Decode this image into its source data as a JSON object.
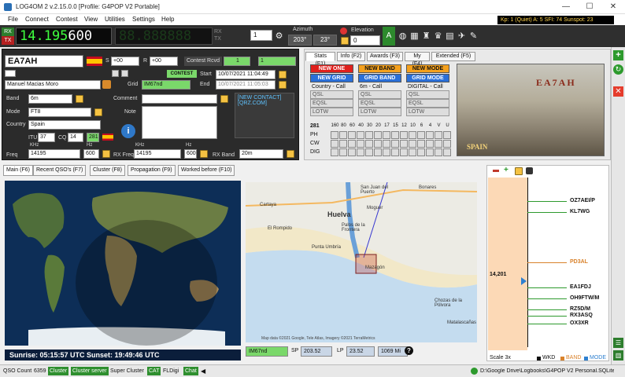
{
  "title": "LOG4OM 2 v.2.15.0.0 [Profile: G4POP V2 Portable]",
  "window_controls": {
    "minimize": "—",
    "maximize": "☐",
    "close": "✕"
  },
  "menu": [
    "File",
    "Connect",
    "Contest",
    "View",
    "Utilities",
    "Settings",
    "Help"
  ],
  "solar": "Kp: 1 (Quiet)  A: 5  SFI: 74 Sunspot: 23",
  "radio": {
    "rx_label": "RX",
    "tx_label": "TX",
    "freq_green": "14.195",
    "freq_white": "600",
    "stepper": "1",
    "azimuth_label": "Azimuth",
    "az_sp": "203°",
    "az_lp": "23°",
    "elevation_label": "Elevation",
    "elevation": "0"
  },
  "qso": {
    "callsign": "EA7AH",
    "s_rst": "+00",
    "r_rst": "+00",
    "contest_rcvd_label": "Contest Rcvd",
    "contest_rcvd": "1",
    "contest_rcvd2": "1",
    "contest_label": "CONTEST",
    "name": "Manuel Macias Moro",
    "grid_label": "Grid",
    "grid": "IM67nd",
    "start_label": "Start",
    "start": "10/07/2021 11:04:49",
    "end_label": "End",
    "end": "10/07/2021 11:05:03",
    "band_label": "Band",
    "band": "6m",
    "mode_label": "Mode",
    "mode": "FT8",
    "country_label": "Country",
    "country": "Spain",
    "comment_label": "Comment",
    "note_label": "Note",
    "itu_label": "ITU",
    "itu": "37",
    "cq_label": "CQ",
    "cq": "14",
    "dxcc": "281",
    "freq_label": "Freq",
    "khz_label": "KHz",
    "hz_label": "Hz",
    "freq_khz": "14195",
    "freq_hz": "600",
    "rxfreq_label": "RX Freq",
    "rx_khz": "14195",
    "rx_hz": "600",
    "rxband_label": "RX Band",
    "rx_band": "20m",
    "new_contact": "[NEW CONTACT]",
    "qrz": "[QRZ.COM]",
    "s_label": "S",
    "r_label": "R"
  },
  "stats": {
    "tabs": [
      "Stats (F1)",
      "Info (F2)",
      "Awards (F3)",
      "My (F4)",
      "Extended (F5)"
    ],
    "new_one": "NEW ONE",
    "new_grid": "NEW GRID",
    "new_band": "NEW BAND",
    "grid_band": "GRID BAND",
    "new_mode": "NEW MODE",
    "grid_mode": "GRID MODE",
    "col1_title": "Country - Call",
    "col2_title": "6m - Call",
    "col3_title": "DIGITAL - Call",
    "qsl": [
      "QSL",
      "EQSL",
      "LOTW"
    ],
    "dxcc": "281",
    "bands": [
      "160",
      "80",
      "60",
      "40",
      "30",
      "20",
      "17",
      "15",
      "12",
      "10",
      "6",
      "4",
      "V",
      "U"
    ],
    "modes": [
      "PH",
      "CW",
      "DIG"
    ],
    "card_call": "EA7AH",
    "card_country": "SPAIN"
  },
  "lower_tabs": [
    "Main (F6)",
    "Recent QSO's (F7)",
    "Cluster (F8)",
    "Propagation (F9)",
    "Worked before (F10)"
  ],
  "sun": "Sunrise: 05:15:57 UTC  Sunset: 19:49:46 UTC",
  "map": {
    "places": [
      "Huelva",
      "San Juan del Puerto",
      "Bonares",
      "Cartaya",
      "Moguer",
      "El Rompido",
      "Palos de la Frontera",
      "Punta Umbría",
      "Mazagón",
      "Matalascañas",
      "Chozas de la Pólvora"
    ],
    "attribution": "Map data ©2021 Google, Tele Atlas, Imagery ©2021 TerraMetrics",
    "locator": "IM67nd",
    "sp_label": "SP",
    "sp": "203.52",
    "lp_label": "LP",
    "lp": "23.52",
    "distance": "1069 Mi"
  },
  "bandmap": {
    "freq_mark": "14,201",
    "spots": [
      {
        "call": "OZ7AEI/P",
        "color": "#111111"
      },
      {
        "call": "KL7WG",
        "color": "#111111"
      },
      {
        "call": "PD3AL",
        "color": "#d9822b"
      },
      {
        "call": "EA1FDJ",
        "color": "#111111"
      },
      {
        "call": "OH9FTW/M",
        "color": "#111111"
      },
      {
        "call": "RZ5D/M",
        "color": "#111111"
      },
      {
        "call": "RX3ASQ",
        "color": "#111111"
      },
      {
        "call": "OX3XR",
        "color": "#111111"
      }
    ],
    "scale": "Scale 3x",
    "legend": [
      {
        "label": "WKD",
        "color": "#111111"
      },
      {
        "label": "BAND",
        "color": "#d9822b"
      },
      {
        "label": "MODE",
        "color": "#2f80d0"
      }
    ]
  },
  "status": {
    "qso_count_label": "QSO Count",
    "qso_count": "6359",
    "items": [
      "Cluster",
      "Cluster server",
      "Super Cluster",
      "CAT",
      "FLDigi",
      "Chat"
    ],
    "db_path": "D:\\Google Drive\\Logbooks\\G4POP V2 Personal.SQLite"
  }
}
